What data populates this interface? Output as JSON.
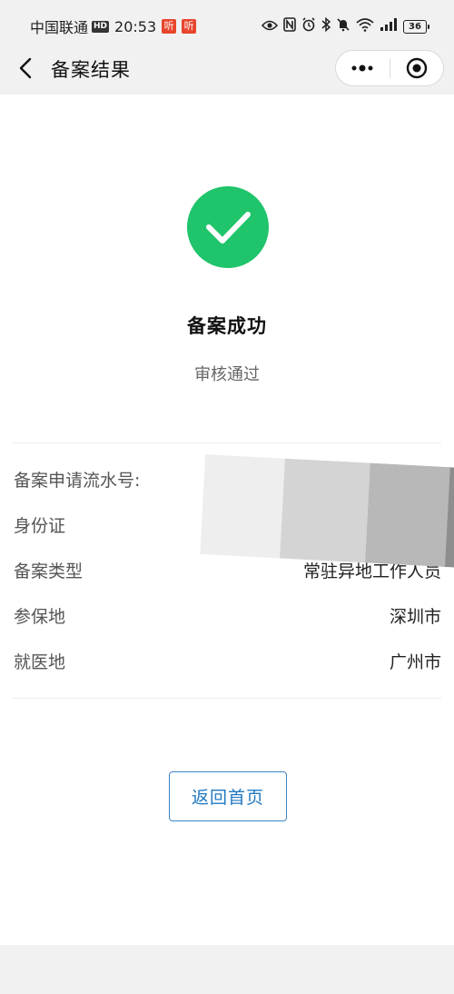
{
  "status_bar": {
    "carrier": "中国联通",
    "hd": "HD",
    "time": "20:53",
    "app_badge_1": "听",
    "app_badge_2": "听",
    "battery": "36"
  },
  "nav": {
    "title": "备案结果",
    "more_icon": "more-dots-icon",
    "close_icon": "target-close-icon"
  },
  "result": {
    "icon": "check-circle-icon",
    "icon_color": "#1fc46b",
    "title": "备案成功",
    "subtitle": "审核通过"
  },
  "details": [
    {
      "label": "备案申请流水号:",
      "value": ""
    },
    {
      "label": "身份证",
      "value": ""
    },
    {
      "label": "备案类型",
      "value": "常驻异地工作人员"
    },
    {
      "label": "参保地",
      "value": "深圳市"
    },
    {
      "label": "就医地",
      "value": "广州市"
    }
  ],
  "actions": {
    "home_button": "返回首页",
    "home_button_color": "#1f78c1"
  }
}
